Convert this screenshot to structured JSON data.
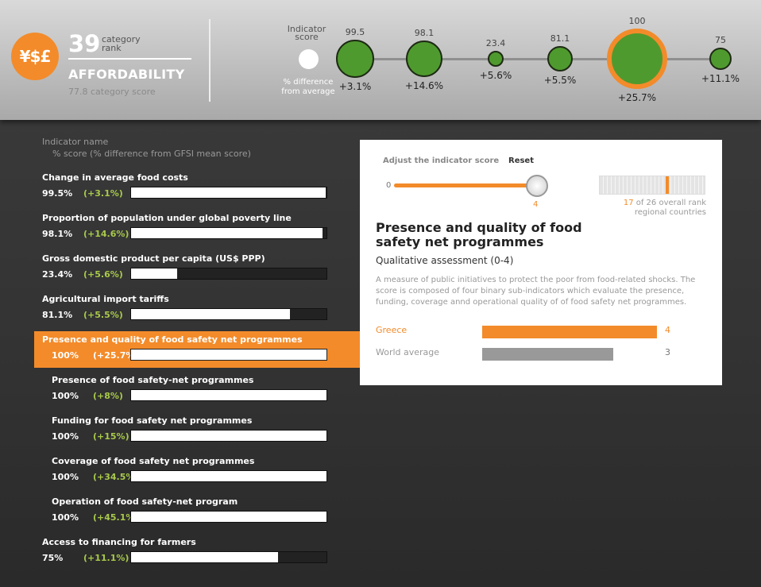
{
  "header": {
    "icon_symbols": "¥$£",
    "category_rank": "39",
    "category_rank_label": "category rank",
    "category_name": "AFFORDABILITY",
    "category_score": "77.8 category score",
    "indicator_score_label": "Indicator score",
    "pct_difference_label": "% difference from average",
    "bubbles": [
      {
        "score": "99.5",
        "diff": "+3.1%",
        "value": 99.5
      },
      {
        "score": "98.1",
        "diff": "+14.6%",
        "value": 98.1
      },
      {
        "score": "23.4",
        "diff": "+5.6%",
        "value": 23.4
      },
      {
        "score": "81.1",
        "diff": "+5.5%",
        "value": 81.1
      },
      {
        "score": "100",
        "diff": "+25.7%",
        "value": 100,
        "selected": true
      },
      {
        "score": "75",
        "diff": "+11.1%",
        "value": 75
      }
    ]
  },
  "list": {
    "heading_name": "Indicator name",
    "heading_score": "% score (% difference from GFSI mean score)",
    "rows": [
      {
        "name": "Change in average food costs",
        "pct": "99.5%",
        "diff": "(+3.1%)",
        "value": 99.5,
        "indent": false
      },
      {
        "name": "Proportion of population under global poverty line",
        "pct": "98.1%",
        "diff": "(+14.6%)",
        "value": 98.1,
        "indent": false
      },
      {
        "name": "Gross domestic product per capita (US$ PPP)",
        "pct": "23.4%",
        "diff": "(+5.6%)",
        "value": 23.4,
        "indent": false
      },
      {
        "name": "Agricultural import tariffs",
        "pct": "81.1%",
        "diff": "(+5.5%)",
        "value": 81.1,
        "indent": false
      },
      {
        "name": "Presence and quality of food safety net programmes",
        "pct": "100%",
        "diff": "(+25.7%)",
        "value": 100,
        "indent": false,
        "selected": true
      },
      {
        "name": "Presence of food safety-net programmes",
        "pct": "100%",
        "diff": "(+8%)",
        "value": 100,
        "indent": true
      },
      {
        "name": "Funding for food safety net programmes",
        "pct": "100%",
        "diff": "(+15%)",
        "value": 100,
        "indent": true
      },
      {
        "name": "Coverage of food safety net programmes",
        "pct": "100%",
        "diff": "(+34.5%)",
        "value": 100,
        "indent": true
      },
      {
        "name": "Operation of food safety-net program",
        "pct": "100%",
        "diff": "(+45.1%)",
        "value": 100,
        "indent": true
      },
      {
        "name": "Access to financing for farmers",
        "pct": "75%",
        "diff": "(+11.1%)",
        "value": 75,
        "indent": false
      }
    ]
  },
  "panel": {
    "adjust_label": "Adjust the indicator score",
    "reset_label": "Reset",
    "slider_min": "0",
    "slider_value": "4",
    "slider_fraction": 1.0,
    "rank_value": "17",
    "rank_text": " of 26 overall rank",
    "rank_text_2": "regional countries",
    "rank_fraction": 0.62,
    "title": "Presence and quality of food safety net programmes",
    "subtitle": "Qualitative assessment (0-4)",
    "description": "A measure of public initiatives to protect the poor from food-related shocks. The score is composed of four binary sub-indicators which evaluate the presence, funding, coverage annd operational quality of of food safety net programmes.",
    "comparison": [
      {
        "label": "Greece",
        "value_text": "4",
        "value": 4,
        "color": "#f38b2a"
      },
      {
        "label": "World average",
        "value_text": "3",
        "value": 3,
        "color": "#999999"
      }
    ],
    "comparison_max": 4
  },
  "colors": {
    "accent": "#f38b2a",
    "bubble_green": "#4f9a2e",
    "diff_green": "#a8c94b"
  }
}
